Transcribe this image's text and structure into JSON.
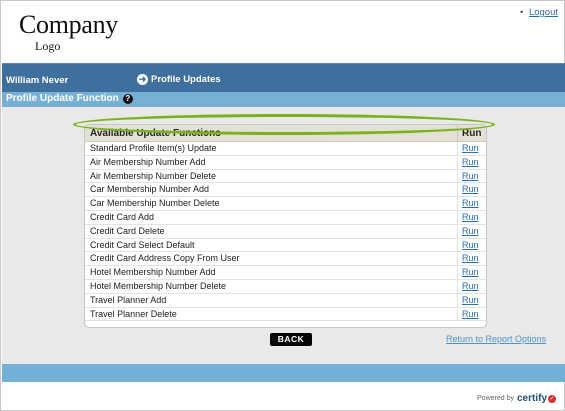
{
  "logo": {
    "line1": "Company",
    "line2": "Logo"
  },
  "header": {
    "logout_label": "Logout"
  },
  "nav": {
    "user_name": "William Never",
    "breadcrumb": "Profile Updates",
    "breadcrumb_icon": "arrow-right-circle-icon"
  },
  "section": {
    "title": "Profile Update Function",
    "help_icon": "help-icon"
  },
  "table": {
    "headers": {
      "function": "Available Update Functions",
      "run": "Run"
    },
    "rows": [
      {
        "label": "Standard Profile Item(s) Update",
        "run": "Run"
      },
      {
        "label": "Air Membership Number Add",
        "run": "Run"
      },
      {
        "label": "Air Membership Number Delete",
        "run": "Run"
      },
      {
        "label": "Car Membership Number Add",
        "run": "Run"
      },
      {
        "label": "Car Membership Number Delete",
        "run": "Run"
      },
      {
        "label": "Credit Card Add",
        "run": "Run"
      },
      {
        "label": "Credit Card Delete",
        "run": "Run"
      },
      {
        "label": "Credit Card Select Default",
        "run": "Run"
      },
      {
        "label": "Credit Card Address Copy From User",
        "run": "Run"
      },
      {
        "label": "Hotel Membership Number Add",
        "run": "Run"
      },
      {
        "label": "Hotel Membership Number Delete",
        "run": "Run"
      },
      {
        "label": "Travel Planner Add",
        "run": "Run"
      },
      {
        "label": "Travel Planner Delete",
        "run": "Run"
      }
    ]
  },
  "actions": {
    "back_label": "BACK",
    "return_label": "Return to Report Options"
  },
  "footer": {
    "powered_by": "Powered by",
    "brand": "certify"
  },
  "colors": {
    "nav": "#3e6f9d",
    "section": "#77b0d3",
    "highlight": "#78b21d",
    "link": "#2a6fb0"
  }
}
